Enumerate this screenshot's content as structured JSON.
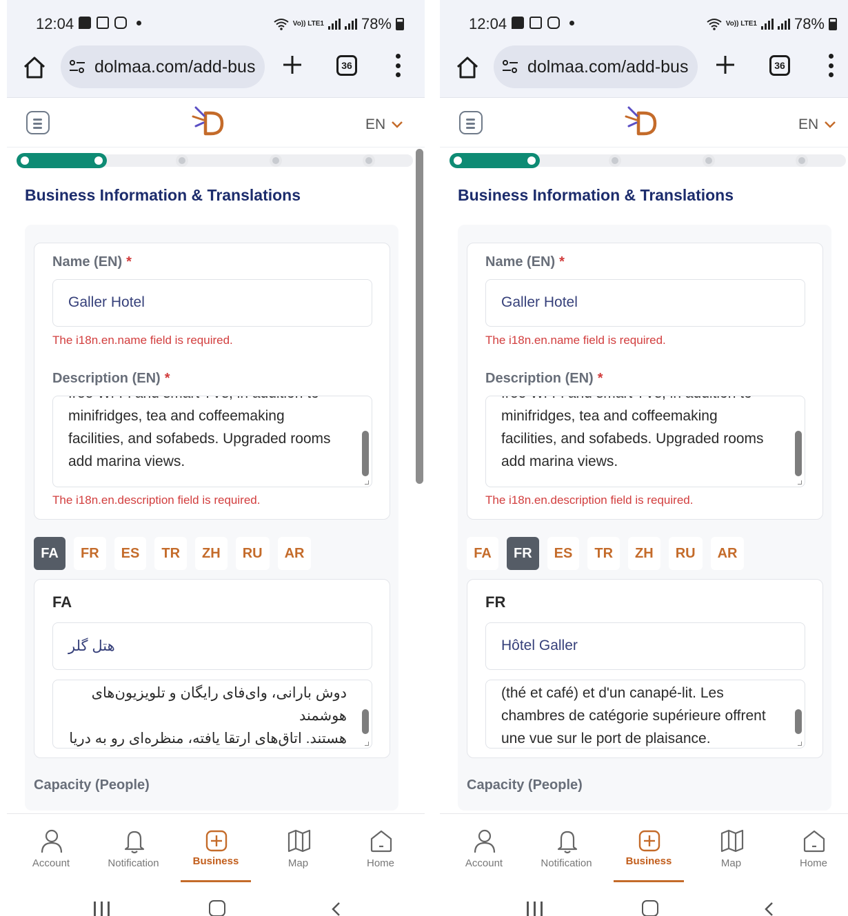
{
  "screens": [
    {
      "status": {
        "time": "12:04",
        "network": "Vo)) LTE1",
        "battery": "78%"
      },
      "browser": {
        "url": "dolmaa.com/add-bus",
        "tab_count": "36"
      },
      "header": {
        "language": "EN"
      },
      "progress": {
        "current_step": 1,
        "total_steps": 5
      },
      "section_title": "Business Information & Translations",
      "name_field": {
        "label": "Name (EN)",
        "required_mark": "*",
        "value": "Galler Hotel",
        "error": "The i18n.en.name field is required."
      },
      "description_field": {
        "label": "Description (EN)",
        "required_mark": "*",
        "clipped_line": "free Wi-Fi and smart TVs, in addition to",
        "visible_text": "minifridges, tea and coffeemaking\nfacilities, and sofabeds. Upgraded rooms\nadd marina views.",
        "error": "The i18n.en.description field is required."
      },
      "lang_tabs": [
        "FA",
        "FR",
        "ES",
        "TR",
        "ZH",
        "RU",
        "AR"
      ],
      "active_lang": "FA",
      "translation": {
        "heading": "FA",
        "name_value": "هتل گلر",
        "description_visible": "دوش بارانی، وای‌فای رایگان و تلویزیون‌های هوشمند\nهستند. اتاق‌های ارتقا یافته، منظره‌ای رو به دریا\nدارند."
      },
      "capacity_label": "Capacity (People)",
      "bottom_nav": [
        {
          "label": "Account",
          "icon": "account-icon"
        },
        {
          "label": "Notification",
          "icon": "bell-icon"
        },
        {
          "label": "Business",
          "icon": "add-business-icon"
        },
        {
          "label": "Map",
          "icon": "map-icon"
        },
        {
          "label": "Home",
          "icon": "home-icon"
        }
      ],
      "active_nav": "Business"
    },
    {
      "status": {
        "time": "12:04",
        "network": "Vo)) LTE1",
        "battery": "78%"
      },
      "browser": {
        "url": "dolmaa.com/add-bus",
        "tab_count": "36"
      },
      "header": {
        "language": "EN"
      },
      "progress": {
        "current_step": 1,
        "total_steps": 5
      },
      "section_title": "Business Information & Translations",
      "name_field": {
        "label": "Name (EN)",
        "required_mark": "*",
        "value": "Galler Hotel",
        "error": "The i18n.en.name field is required."
      },
      "description_field": {
        "label": "Description (EN)",
        "required_mark": "*",
        "clipped_line": "free Wi-Fi and smart TVs, in addition to",
        "visible_text": "minifridges, tea and coffeemaking\nfacilities, and sofabeds. Upgraded rooms\nadd marina views.",
        "error": "The i18n.en.description field is required."
      },
      "lang_tabs": [
        "FA",
        "FR",
        "ES",
        "TR",
        "ZH",
        "RU",
        "AR"
      ],
      "active_lang": "FR",
      "translation": {
        "heading": "FR",
        "name_value": "Hôtel Galler",
        "description_visible": "(thé et café) et d'un canapé-lit. Les\nchambres de catégorie supérieure offrent\nune vue sur le port de plaisance."
      },
      "capacity_label": "Capacity (People)",
      "bottom_nav": [
        {
          "label": "Account",
          "icon": "account-icon"
        },
        {
          "label": "Notification",
          "icon": "bell-icon"
        },
        {
          "label": "Business",
          "icon": "add-business-icon"
        },
        {
          "label": "Map",
          "icon": "map-icon"
        },
        {
          "label": "Home",
          "icon": "home-icon"
        }
      ],
      "active_nav": "Business"
    }
  ],
  "colors": {
    "primary_navy": "#1c2c6c",
    "accent_orange": "#c46b2a",
    "progress_green": "#0e8b74",
    "error_red": "#d23d3d",
    "active_tab_gray": "#555c66"
  }
}
